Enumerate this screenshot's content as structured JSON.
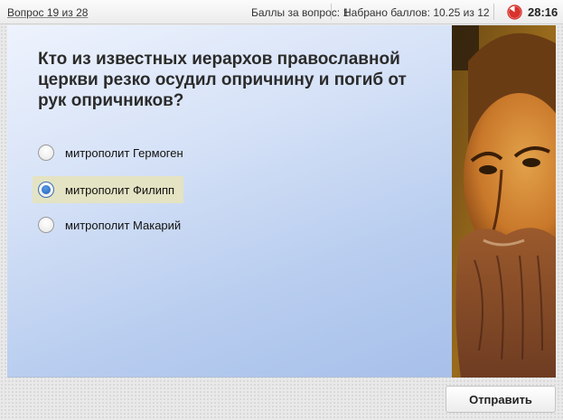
{
  "topbar": {
    "question_counter": "Вопрос 19 из 28",
    "points_per_question": "Баллы за вопрос: 1",
    "score": "Набрано баллов: 10.25 из 12",
    "timer": "28:16",
    "timer_icon": "pie-timer-icon"
  },
  "question": {
    "text": "Кто из известных иерархов православной церкви резко осудил опричнину и погиб от рук опричников?",
    "options": [
      {
        "label": "митрополит Гермоген",
        "selected": false
      },
      {
        "label": "митрополит Филипп",
        "selected": true
      },
      {
        "label": "митрополит Макарий",
        "selected": false
      }
    ]
  },
  "image": {
    "subject": "icon-portrait-bearded-saint"
  },
  "actions": {
    "submit_label": "Отправить"
  },
  "colors": {
    "accent_timer": "#d8322c",
    "selected_option_bg": "#e4e3c3",
    "radio_selected": "#1f5fb8"
  }
}
